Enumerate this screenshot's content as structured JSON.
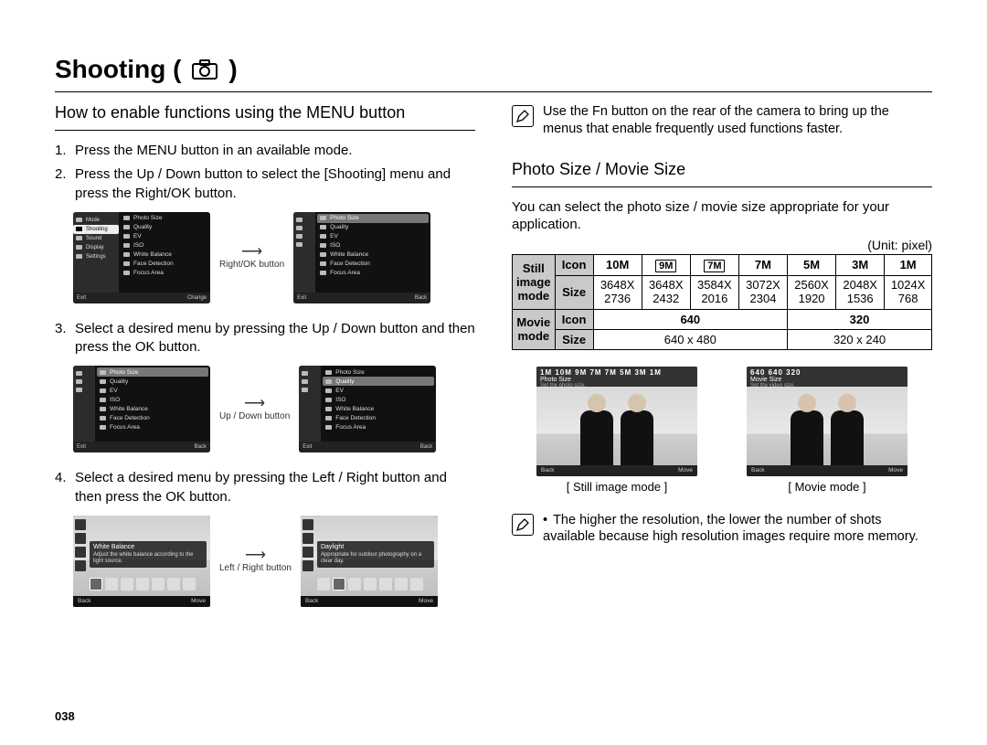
{
  "page_title": "Shooting (",
  "page_title_suffix": ")",
  "section_left_heading": "How to enable functions using the MENU button",
  "steps": [
    {
      "num": "1.",
      "text": "Press the MENU button in an available mode."
    },
    {
      "num": "2.",
      "text": "Press the Up / Down button to select the [Shooting] menu and press the Right/OK button."
    },
    {
      "num": "3.",
      "text": "Select a desired menu by pressing the Up / Down button and then press the OK button."
    },
    {
      "num": "4.",
      "text": "Select a desired menu by pressing the Left / Right button and then press the OK button."
    }
  ],
  "arrows": {
    "right_ok": "Right/OK button",
    "up_down": "Up / Down button",
    "left_right": "Left / Right button"
  },
  "menu_sidebar": {
    "items": [
      "Mode",
      "Shooting",
      "Sound",
      "Display",
      "Settings"
    ]
  },
  "menu_list": {
    "items": [
      "Photo Size",
      "Quality",
      "EV",
      "ISO",
      "White Balance",
      "Face Detection",
      "Focus Area"
    ]
  },
  "menu_footer": {
    "exit": "Exit",
    "change": "Change",
    "back": "Back"
  },
  "note_top": "Use the Fn button on the rear of the camera to bring up the menus that enable frequently used functions faster.",
  "section_right_heading": "Photo Size / Movie Size",
  "intro": "You can select the photo size / movie size appropriate for your application.",
  "unit_label": "(Unit: pixel)",
  "table": {
    "still_mode_head": "Still image mode",
    "movie_mode_head": "Movie mode",
    "row_icon": "Icon",
    "row_size": "Size",
    "still_icons": [
      "10M",
      "9M",
      "7M",
      "7M",
      "5M",
      "3M",
      "1M"
    ],
    "still_icon_boxed": [
      false,
      true,
      true,
      false,
      false,
      false,
      false
    ],
    "still_sizes": [
      "3648X 2736",
      "3648X 2432",
      "3584X 2016",
      "3072X 2304",
      "2560X 1920",
      "2048X 1536",
      "1024X 768"
    ],
    "movie_icons": [
      "640",
      "320"
    ],
    "movie_sizes": [
      "640 x 480",
      "320 x 240"
    ]
  },
  "sample_still": {
    "top_icons": "1M 10M 9M 7M 7M 5M 3M 1M",
    "title": "Photo Size",
    "hint": "Set the photo size.",
    "back": "Back",
    "move": "Move",
    "caption": "[ Still image mode ]"
  },
  "sample_movie": {
    "top_icons": "640  640  320",
    "title": "Movie Size",
    "hint": "Set the video size.",
    "back": "Back",
    "move": "Move",
    "caption": "[ Movie mode ]"
  },
  "wb_left": {
    "hint": "Adjust the white balance according to the light source.",
    "label": "White Balance",
    "back": "Back",
    "move": "Move"
  },
  "wb_right": {
    "hint": "Appropriate for outdoor photography on a clear day.",
    "label": "Daylight",
    "back": "Back",
    "move": "Move"
  },
  "note_bottom": "The higher the resolution, the lower the number of shots available because high resolution images require more memory.",
  "page_number": "038"
}
